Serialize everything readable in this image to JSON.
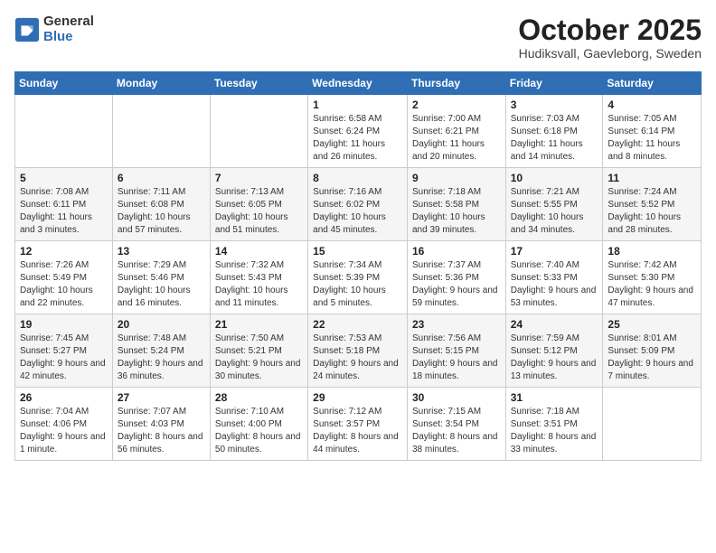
{
  "header": {
    "logo_general": "General",
    "logo_blue": "Blue",
    "month_title": "October 2025",
    "location": "Hudiksvall, Gaevleborg, Sweden"
  },
  "weekdays": [
    "Sunday",
    "Monday",
    "Tuesday",
    "Wednesday",
    "Thursday",
    "Friday",
    "Saturday"
  ],
  "weeks": [
    [
      {
        "day": "",
        "info": ""
      },
      {
        "day": "",
        "info": ""
      },
      {
        "day": "",
        "info": ""
      },
      {
        "day": "1",
        "info": "Sunrise: 6:58 AM\nSunset: 6:24 PM\nDaylight: 11 hours\nand 26 minutes."
      },
      {
        "day": "2",
        "info": "Sunrise: 7:00 AM\nSunset: 6:21 PM\nDaylight: 11 hours\nand 20 minutes."
      },
      {
        "day": "3",
        "info": "Sunrise: 7:03 AM\nSunset: 6:18 PM\nDaylight: 11 hours\nand 14 minutes."
      },
      {
        "day": "4",
        "info": "Sunrise: 7:05 AM\nSunset: 6:14 PM\nDaylight: 11 hours\nand 8 minutes."
      }
    ],
    [
      {
        "day": "5",
        "info": "Sunrise: 7:08 AM\nSunset: 6:11 PM\nDaylight: 11 hours\nand 3 minutes."
      },
      {
        "day": "6",
        "info": "Sunrise: 7:11 AM\nSunset: 6:08 PM\nDaylight: 10 hours\nand 57 minutes."
      },
      {
        "day": "7",
        "info": "Sunrise: 7:13 AM\nSunset: 6:05 PM\nDaylight: 10 hours\nand 51 minutes."
      },
      {
        "day": "8",
        "info": "Sunrise: 7:16 AM\nSunset: 6:02 PM\nDaylight: 10 hours\nand 45 minutes."
      },
      {
        "day": "9",
        "info": "Sunrise: 7:18 AM\nSunset: 5:58 PM\nDaylight: 10 hours\nand 39 minutes."
      },
      {
        "day": "10",
        "info": "Sunrise: 7:21 AM\nSunset: 5:55 PM\nDaylight: 10 hours\nand 34 minutes."
      },
      {
        "day": "11",
        "info": "Sunrise: 7:24 AM\nSunset: 5:52 PM\nDaylight: 10 hours\nand 28 minutes."
      }
    ],
    [
      {
        "day": "12",
        "info": "Sunrise: 7:26 AM\nSunset: 5:49 PM\nDaylight: 10 hours\nand 22 minutes."
      },
      {
        "day": "13",
        "info": "Sunrise: 7:29 AM\nSunset: 5:46 PM\nDaylight: 10 hours\nand 16 minutes."
      },
      {
        "day": "14",
        "info": "Sunrise: 7:32 AM\nSunset: 5:43 PM\nDaylight: 10 hours\nand 11 minutes."
      },
      {
        "day": "15",
        "info": "Sunrise: 7:34 AM\nSunset: 5:39 PM\nDaylight: 10 hours\nand 5 minutes."
      },
      {
        "day": "16",
        "info": "Sunrise: 7:37 AM\nSunset: 5:36 PM\nDaylight: 9 hours\nand 59 minutes."
      },
      {
        "day": "17",
        "info": "Sunrise: 7:40 AM\nSunset: 5:33 PM\nDaylight: 9 hours\nand 53 minutes."
      },
      {
        "day": "18",
        "info": "Sunrise: 7:42 AM\nSunset: 5:30 PM\nDaylight: 9 hours\nand 47 minutes."
      }
    ],
    [
      {
        "day": "19",
        "info": "Sunrise: 7:45 AM\nSunset: 5:27 PM\nDaylight: 9 hours\nand 42 minutes."
      },
      {
        "day": "20",
        "info": "Sunrise: 7:48 AM\nSunset: 5:24 PM\nDaylight: 9 hours\nand 36 minutes."
      },
      {
        "day": "21",
        "info": "Sunrise: 7:50 AM\nSunset: 5:21 PM\nDaylight: 9 hours\nand 30 minutes."
      },
      {
        "day": "22",
        "info": "Sunrise: 7:53 AM\nSunset: 5:18 PM\nDaylight: 9 hours\nand 24 minutes."
      },
      {
        "day": "23",
        "info": "Sunrise: 7:56 AM\nSunset: 5:15 PM\nDaylight: 9 hours\nand 18 minutes."
      },
      {
        "day": "24",
        "info": "Sunrise: 7:59 AM\nSunset: 5:12 PM\nDaylight: 9 hours\nand 13 minutes."
      },
      {
        "day": "25",
        "info": "Sunrise: 8:01 AM\nSunset: 5:09 PM\nDaylight: 9 hours\nand 7 minutes."
      }
    ],
    [
      {
        "day": "26",
        "info": "Sunrise: 7:04 AM\nSunset: 4:06 PM\nDaylight: 9 hours\nand 1 minute."
      },
      {
        "day": "27",
        "info": "Sunrise: 7:07 AM\nSunset: 4:03 PM\nDaylight: 8 hours\nand 56 minutes."
      },
      {
        "day": "28",
        "info": "Sunrise: 7:10 AM\nSunset: 4:00 PM\nDaylight: 8 hours\nand 50 minutes."
      },
      {
        "day": "29",
        "info": "Sunrise: 7:12 AM\nSunset: 3:57 PM\nDaylight: 8 hours\nand 44 minutes."
      },
      {
        "day": "30",
        "info": "Sunrise: 7:15 AM\nSunset: 3:54 PM\nDaylight: 8 hours\nand 38 minutes."
      },
      {
        "day": "31",
        "info": "Sunrise: 7:18 AM\nSunset: 3:51 PM\nDaylight: 8 hours\nand 33 minutes."
      },
      {
        "day": "",
        "info": ""
      }
    ]
  ]
}
